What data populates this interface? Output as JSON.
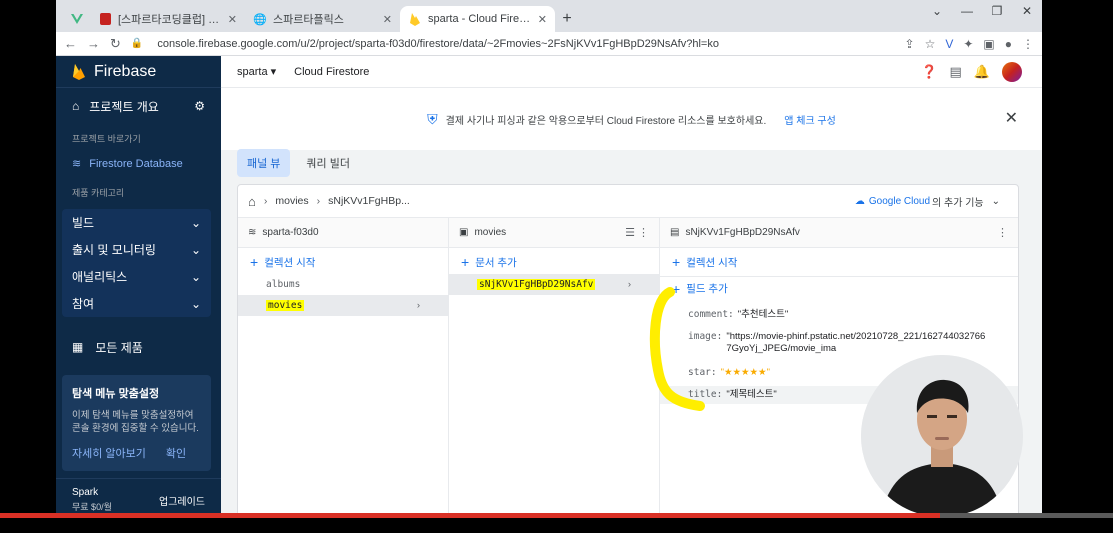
{
  "browser": {
    "tabs": [
      {
        "title": "",
        "icon": "vue-icon"
      },
      {
        "title": "[스파르타코딩클럽] 코딩이 처음",
        "icon": "bookmark-icon"
      },
      {
        "title": "스파르타플릭스",
        "icon": "globe-icon"
      },
      {
        "title": "sparta - Cloud Firestore - Fireba",
        "icon": "firebase-icon"
      }
    ],
    "url": "console.firebase.google.com/u/2/project/sparta-f03d0/firestore/data/~2Fmovies~2FsNjKVv1FgHBpD29NsAfv?hl=ko"
  },
  "sidebar": {
    "brand": "Firebase",
    "overview": "프로젝트 개요",
    "shortcuts_label": "프로젝트 바로가기",
    "active_item": "Firestore Database",
    "category_label": "제품 카테고리",
    "groups": [
      "빌드",
      "출시 및 모니터링",
      "애널리틱스",
      "참여"
    ],
    "all_products": "모든 제품",
    "promo": {
      "title": "탐색 메뉴 맞춤설정",
      "desc": "이제 탐색 메뉴를 맞춤설정하여 콘솔 환경에 집중할 수 있습니다.",
      "learn_more": "자세히 알아보기",
      "confirm": "확인"
    },
    "plan": {
      "name": "Spark",
      "price": "무료 $0/월",
      "upgrade": "업그레이드"
    }
  },
  "topbar": {
    "project": "sparta",
    "service": "Cloud Firestore"
  },
  "banner": {
    "text": "결제 사기나 피싱과 같은 악용으로부터 Cloud Firestore 리소스를 보호하세요.",
    "link": "앱 체크 구성"
  },
  "view_tabs": {
    "panel": "패널 뷰",
    "query": "쿼리 빌더"
  },
  "breadcrumb": {
    "collection": "movies",
    "doc": "sNjKVv1FgHBp...",
    "gcloud": "Google Cloud",
    "gcloud_rest": "의 추가 기능"
  },
  "col1": {
    "title": "sparta-f03d0",
    "add": "컬렉션 시작",
    "items": [
      "albums",
      "movies"
    ]
  },
  "col2": {
    "title": "movies",
    "add": "문서 추가",
    "items": [
      "sNjKVv1FgHBpD29NsAfv"
    ]
  },
  "col3": {
    "title": "sNjKVv1FgHBpD29NsAfv",
    "add_collection": "컬렉션 시작",
    "add_field": "필드 추가",
    "fields": [
      {
        "key": "comment:",
        "value": "\"추천테스트\""
      },
      {
        "key": "image:",
        "value": "\"https://movie-phinf.pstatic.net/20210728_221/1627440327667GyoYj_JPEG/movie_ima"
      },
      {
        "key": "star:",
        "value": "\"★★★★★\""
      },
      {
        "key": "title:",
        "value": "\"제목테스트\""
      }
    ]
  },
  "colors": {
    "sidebar_bg": "#0e2a47",
    "accent": "#1a73e8",
    "highlight": "#ffff00"
  }
}
